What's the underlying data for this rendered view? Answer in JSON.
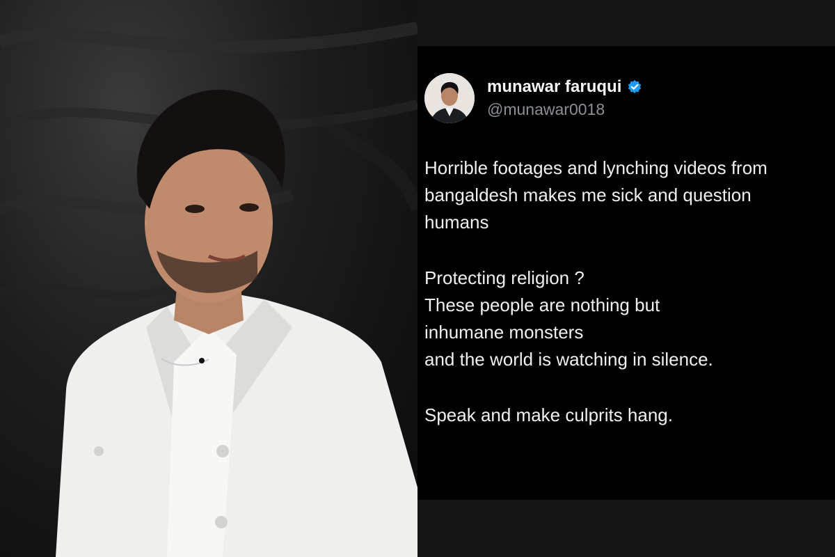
{
  "tweet": {
    "display_name": "munawar faruqui",
    "handle": "@munawar0018",
    "verified_icon": "verified-badge-icon",
    "verified_color": "#1d9bf0",
    "paragraphs": [
      [
        "Horrible footages and lynching videos from",
        "bangaldesh makes me sick and question",
        "humans"
      ],
      [
        "Protecting religion ?",
        "These people are nothing but",
        "inhumane monsters",
        "and the world is watching in silence."
      ],
      [
        "Speak and make culprits hang."
      ]
    ]
  },
  "photo": {
    "subject": "man in white suit against dark backdrop"
  },
  "colors": {
    "background": "#000000",
    "band": "#151515",
    "text": "#f0f0f0",
    "handle": "#8b9096"
  }
}
